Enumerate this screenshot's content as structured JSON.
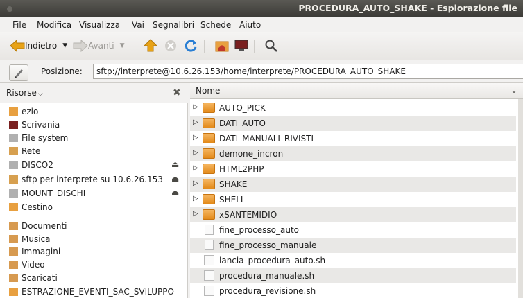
{
  "window": {
    "title": "PROCEDURA_AUTO_SHAKE - Esplorazione file"
  },
  "menu": [
    "File",
    "Modifica",
    "Visualizza",
    "Vai",
    "Segnalibri",
    "Schede",
    "Aiuto"
  ],
  "toolbar": {
    "back_label": "Indietro",
    "forward_label": "Avanti"
  },
  "location": {
    "label": "Posizione:",
    "value": "sftp://interprete@10.6.26.153/home/interprete/PROCEDURA_AUTO_SHAKE"
  },
  "sidebar": {
    "header": "Risorse",
    "devices": [
      {
        "label": "ezio",
        "icon": "home-folder-icon",
        "color": "#e8a040"
      },
      {
        "label": "Scrivania",
        "icon": "desktop-icon",
        "color": "#7a2020"
      },
      {
        "label": "File system",
        "icon": "drive-icon",
        "color": "#b0b0b0"
      },
      {
        "label": "Rete",
        "icon": "network-icon",
        "color": "#d7a050"
      },
      {
        "label": "DISCO2",
        "icon": "drive-icon",
        "color": "#b0b0b0",
        "eject": "⏏"
      },
      {
        "label": "sftp per interprete su 10.6.26.153",
        "icon": "network-share-icon",
        "color": "#d7a050",
        "eject": "⏏"
      },
      {
        "label": "MOUNT_DISCHI",
        "icon": "drive-icon",
        "color": "#b0b0b0",
        "eject": "⏏"
      },
      {
        "label": "Cestino",
        "icon": "trash-icon",
        "color": "#e8a040"
      }
    ],
    "bookmarks": [
      {
        "label": "Documenti",
        "icon": "documents-folder-icon",
        "color": "#d79a50"
      },
      {
        "label": "Musica",
        "icon": "music-folder-icon",
        "color": "#d79a50"
      },
      {
        "label": "Immagini",
        "icon": "pictures-folder-icon",
        "color": "#d79a50"
      },
      {
        "label": "Video",
        "icon": "video-folder-icon",
        "color": "#d79a50"
      },
      {
        "label": "Scaricati",
        "icon": "downloads-folder-icon",
        "color": "#d79a50"
      },
      {
        "label": "ESTRAZIONE_EVENTI_SAC_SVILUPPO",
        "icon": "folder-icon",
        "color": "#e8a040"
      }
    ]
  },
  "list": {
    "column": "Nome",
    "items": [
      {
        "name": "AUTO_PICK",
        "type": "folder"
      },
      {
        "name": "DATI_AUTO",
        "type": "folder"
      },
      {
        "name": "DATI_MANUALI_RIVISTI",
        "type": "folder"
      },
      {
        "name": "demone_incron",
        "type": "folder"
      },
      {
        "name": "HTML2PHP",
        "type": "folder"
      },
      {
        "name": "SHAKE",
        "type": "folder"
      },
      {
        "name": "SHELL",
        "type": "folder"
      },
      {
        "name": "xSANTEMIDIO",
        "type": "folder"
      },
      {
        "name": "fine_processo_auto",
        "type": "file"
      },
      {
        "name": "fine_processo_manuale",
        "type": "file"
      },
      {
        "name": "lancia_procedura_auto.sh",
        "type": "script"
      },
      {
        "name": "procedura_manuale.sh",
        "type": "script"
      },
      {
        "name": "procedura_revisione.sh",
        "type": "script"
      }
    ]
  }
}
